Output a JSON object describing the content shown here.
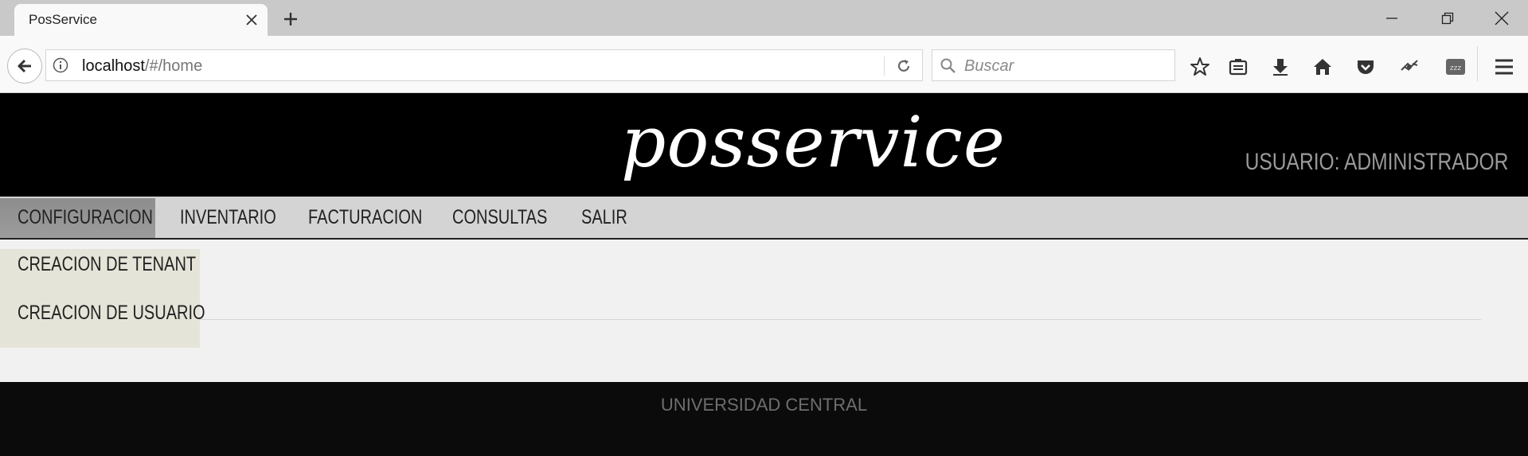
{
  "browser": {
    "tab_title": "PosService",
    "url_host": "localhost",
    "url_path": "/#/home",
    "search_placeholder": "Buscar"
  },
  "site": {
    "logo": "posservice",
    "user_label": "USUARIO: ADMINISTRADOR"
  },
  "menu": {
    "items": [
      {
        "label": "CONFIGURACION",
        "active": true
      },
      {
        "label": "INVENTARIO"
      },
      {
        "label": "FACTURACION"
      },
      {
        "label": "CONSULTAS"
      },
      {
        "label": "SALIR"
      }
    ],
    "dropdown": [
      {
        "label": "CREACION DE TENANT"
      },
      {
        "label": "CREACION DE USUARIO"
      }
    ]
  },
  "footer": {
    "text": "UNIVERSIDAD CENTRAL"
  },
  "icons": {
    "toolbar": [
      "star-icon",
      "reading-list-icon",
      "download-icon",
      "home-icon",
      "pocket-icon",
      "extension-icon",
      "extension-zzz-icon",
      "hamburger-menu-icon"
    ]
  },
  "colors": {
    "header_bg": "#000000",
    "menubar_bg": "#d4d4d4",
    "dropdown_bg": "#e5e4d8",
    "footer_bg": "#0b0b0b"
  }
}
